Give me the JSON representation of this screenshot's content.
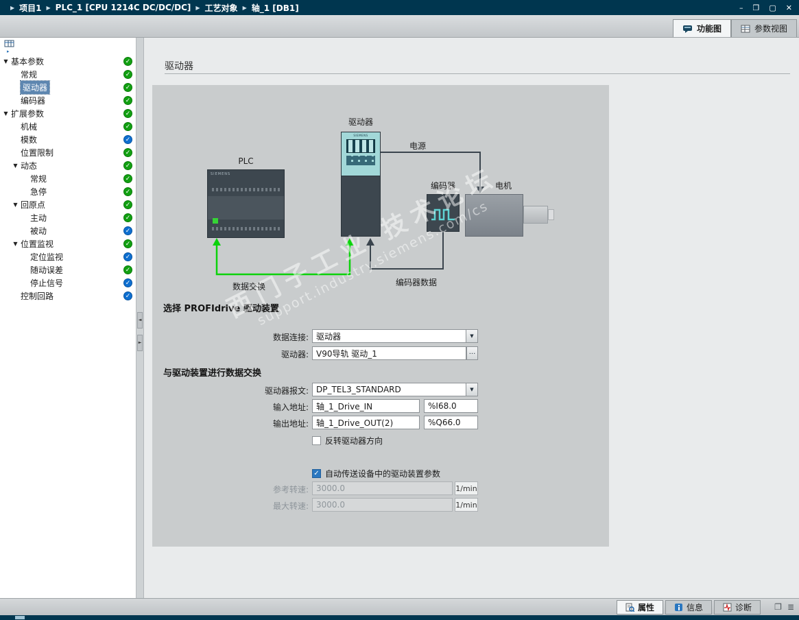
{
  "icons": {
    "minimize": "–",
    "restore": "❐",
    "maximize": "▢",
    "close": "✕",
    "dropdown": "▼",
    "check": "✓",
    "sash_left": "◄",
    "sash_right": "►",
    "panel_toggle": "❐",
    "list_menu": "≣"
  },
  "colors": {
    "titlebar_bg": "#00364f",
    "status_green": "#12a012",
    "status_blue": "#0e6fd0",
    "data_exchange_green": "#0bd20b",
    "checkbox_blue": "#2a77c0",
    "drive_screen_teal": "#a2d8d8"
  },
  "titlebar": {
    "items": [
      {
        "label": "项目1"
      },
      {
        "label": "PLC_1 [CPU 1214C DC/DC/DC]"
      },
      {
        "label": "工艺对象"
      },
      {
        "label": "轴_1 [DB1]"
      }
    ]
  },
  "view_tabs": {
    "function_view": "功能图",
    "parameter_view": "参数视图"
  },
  "sidebar": {
    "items": [
      {
        "label": "基本参数",
        "level": 0,
        "arrow": true,
        "status": "green",
        "selected": false
      },
      {
        "label": "常规",
        "level": 1,
        "arrow": false,
        "status": "green",
        "selected": false
      },
      {
        "label": "驱动器",
        "level": 1,
        "arrow": false,
        "status": "green",
        "selected": true
      },
      {
        "label": "编码器",
        "level": 1,
        "arrow": false,
        "status": "green",
        "selected": false
      },
      {
        "label": "扩展参数",
        "level": 0,
        "arrow": true,
        "status": "green",
        "selected": false
      },
      {
        "label": "机械",
        "level": 1,
        "arrow": false,
        "status": "green",
        "selected": false
      },
      {
        "label": "模数",
        "level": 1,
        "arrow": false,
        "status": "blue",
        "selected": false
      },
      {
        "label": "位置限制",
        "level": 1,
        "arrow": false,
        "status": "green",
        "selected": false
      },
      {
        "label": "动态",
        "level": 1,
        "arrow": true,
        "status": "green",
        "selected": false
      },
      {
        "label": "常规",
        "level": 2,
        "arrow": false,
        "status": "green",
        "selected": false
      },
      {
        "label": "急停",
        "level": 2,
        "arrow": false,
        "status": "green",
        "selected": false
      },
      {
        "label": "回原点",
        "level": 1,
        "arrow": true,
        "status": "green",
        "selected": false
      },
      {
        "label": "主动",
        "level": 2,
        "arrow": false,
        "status": "green",
        "selected": false
      },
      {
        "label": "被动",
        "level": 2,
        "arrow": false,
        "status": "blue",
        "selected": false
      },
      {
        "label": "位置监视",
        "level": 1,
        "arrow": true,
        "status": "green",
        "selected": false
      },
      {
        "label": "定位监视",
        "level": 2,
        "arrow": false,
        "status": "blue",
        "selected": false
      },
      {
        "label": "随动误差",
        "level": 2,
        "arrow": false,
        "status": "green",
        "selected": false
      },
      {
        "label": "停止信号",
        "level": 2,
        "arrow": false,
        "status": "blue",
        "selected": false
      },
      {
        "label": "控制回路",
        "level": 1,
        "arrow": false,
        "status": "blue",
        "selected": false
      }
    ]
  },
  "main": {
    "page_title": "驱动器",
    "diagram": {
      "plc_label": "PLC",
      "drive_label": "驱动器",
      "encoder_label": "编码器",
      "motor_label": "电机",
      "power_label": "电源",
      "data_exchange_label": "数据交换",
      "encoder_data_label": "编码器数据",
      "siemens_text": "SIEMENS",
      "watermark_cn": "西门子工业 技术论坛",
      "watermark_url": "support.industry.siemens.com/cs"
    },
    "form": {
      "section_select_title": "选择 PROFIdrive 驱动装置",
      "data_connection_label": "数据连接:",
      "data_connection_value": "驱动器",
      "drive_label": "驱动器:",
      "drive_value": "V90导轨 驱动_1",
      "browse_button": "...",
      "section_exchange_title": "与驱动装置进行数据交换",
      "telegram_label": "驱动器报文:",
      "telegram_value": "DP_TEL3_STANDARD",
      "input_addr_label": "输入地址:",
      "input_addr_name": "轴_1_Drive_IN",
      "input_addr_value": "%I68.0",
      "output_addr_label": "输出地址:",
      "output_addr_name": "轴_1_Drive_OUT(2)",
      "output_addr_value": "%Q66.0",
      "invert_checkbox_label": "反转驱动器方向",
      "invert_checked": false,
      "auto_transfer_checkbox_label": "自动传送设备中的驱动装置参数",
      "auto_transfer_checked": true,
      "ref_speed_label": "参考转速:",
      "ref_speed_value": "3000.0",
      "ref_speed_unit": "1/min",
      "max_speed_label": "最大转速:",
      "max_speed_value": "3000.0",
      "max_speed_unit": "1/min"
    }
  },
  "bottom_bar": {
    "properties": "属性",
    "info": "信息",
    "diagnostics": "诊断"
  }
}
